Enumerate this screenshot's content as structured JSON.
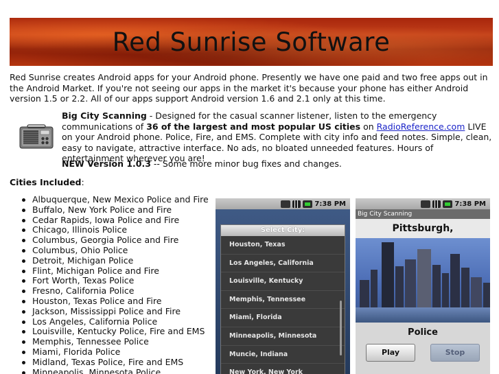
{
  "banner": {
    "title": "Red Sunrise Software"
  },
  "intro": "Red Sunrise creates Android apps for your Android phone. Presently we have one paid and two free apps out in the Android Market. If you're not seeing our apps in the market it's because your phone has either Android version 1.5 or 2.2. All of our apps support Android version 1.6 and 2.1 only at this time.",
  "app": {
    "name": "Big City Scanning",
    "desc_part1": " - Designed for the casual scanner listener, listen to the emergency communications of ",
    "desc_bold": "36 of the largest and most popular US cities",
    "desc_part2": " on ",
    "link_text": "RadioReference.com",
    "desc_part3": " LIVE on your Android phone. Police, Fire, and EMS. Complete with city info and feed notes. Simple, clean, easy to navigate, attractive interface. No ads, no bloated unneeded features. Hours of entertainment wherever you are!",
    "icon": "radio-icon"
  },
  "version": {
    "label": "NEW Version 1.0.3",
    "text": " -- Some more minor bug fixes and changes."
  },
  "cities": {
    "heading": "Cities Included",
    "colon": ":",
    "items": [
      "Albuquerque, New Mexico Police and Fire",
      "Buffalo, New York Police and Fire",
      "Cedar Rapids, Iowa Police and Fire",
      "Chicago, Illinois Police",
      "Columbus, Georgia Police and Fire",
      "Columbus, Ohio Police",
      "Detroit, Michigan Police",
      "Flint, Michigan Police and Fire",
      "Fort Worth, Texas Police",
      "Fresno, California Police",
      "Houston, Texas Police and Fire",
      "Jackson, Mississippi Police and Fire",
      "Los Angeles, California Police",
      "Louisville, Kentucky Police, Fire and EMS",
      "Memphis, Tennessee Police",
      "Miami, Florida Police",
      "Midland, Texas Police, Fire and EMS",
      "Minneapolis, Minnesota Police"
    ]
  },
  "phone1": {
    "status_time": "7:38 PM",
    "dialog_title": "Select City:",
    "cities": [
      "Houston, Texas",
      "Los Angeles, California",
      "Louisville, Kentucky",
      "Memphis, Tennessee",
      "Miami, Florida",
      "Minneapolis, Minnesota",
      "Muncie, Indiana",
      "New York, New York"
    ]
  },
  "phone2": {
    "status_time": "7:38 PM",
    "app_title": "Big City Scanning",
    "city": "Pittsburgh, Pennsylvania",
    "feed_label": "Police",
    "play_label": "Play",
    "stop_label": "Stop"
  }
}
